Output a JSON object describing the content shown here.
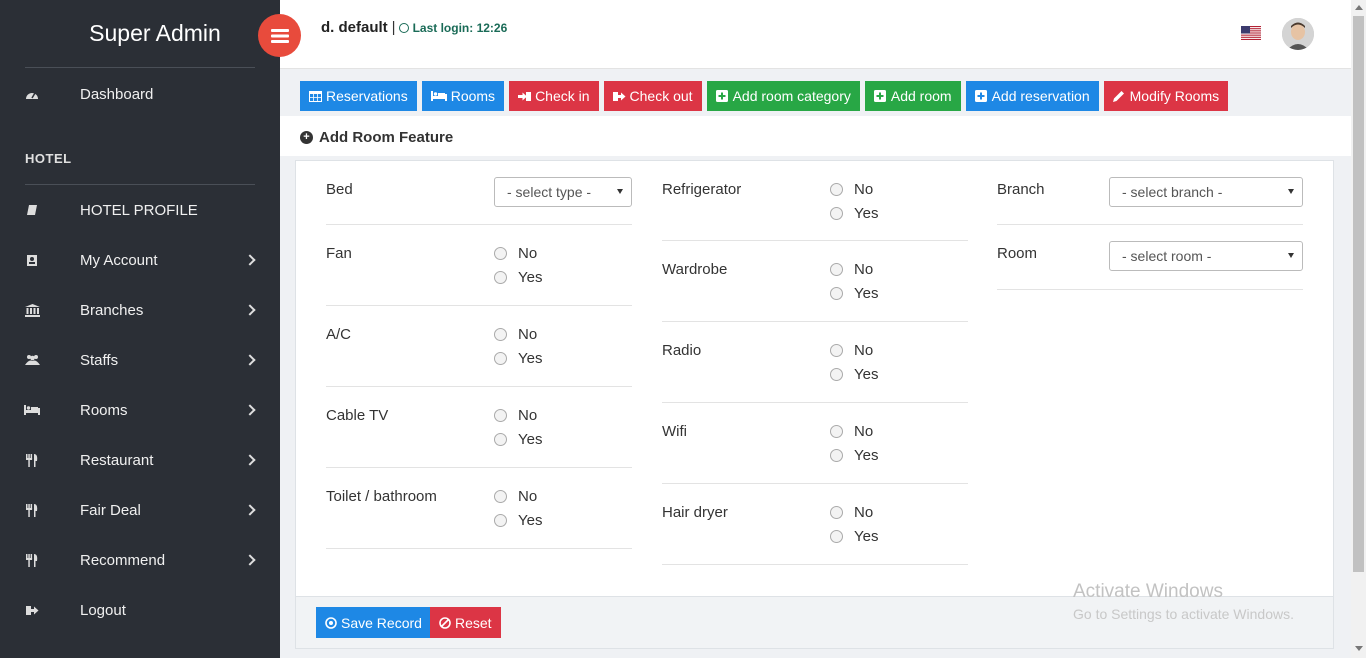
{
  "sidebar": {
    "brand": "Super Admin",
    "dashboard": {
      "label": "Dashboard",
      "icon": "dashboard-icon"
    },
    "section_title": "HOTEL",
    "items": [
      {
        "label": "HOTEL PROFILE",
        "icon": "book-icon"
      },
      {
        "label": "My Account",
        "icon": "account-icon"
      },
      {
        "label": "Branches",
        "icon": "bank-icon"
      },
      {
        "label": "Staffs",
        "icon": "users-icon"
      },
      {
        "label": "Rooms",
        "icon": "bed-icon"
      },
      {
        "label": "Restaurant",
        "icon": "cutlery-icon"
      },
      {
        "label": "Fair Deal",
        "icon": "cutlery-icon"
      },
      {
        "label": "Recommend",
        "icon": "cutlery-icon"
      },
      {
        "label": "Logout",
        "icon": "sign-out-icon"
      }
    ]
  },
  "header": {
    "user_name": "d. default",
    "separator": "|",
    "last_login": "Last login: 12:26"
  },
  "actions": [
    {
      "label": "Reservations",
      "color": "#1e88e5",
      "icon": "calendar-icon"
    },
    {
      "label": "Rooms",
      "color": "#1e88e5",
      "icon": "bed-icon"
    },
    {
      "label": "Check in",
      "color": "#dc3545",
      "icon": "sign-in-icon"
    },
    {
      "label": "Check out",
      "color": "#dc3545",
      "icon": "sign-out-icon"
    },
    {
      "label": "Add room category",
      "color": "#28a745",
      "icon": "plus-square-icon"
    },
    {
      "label": "Add room",
      "color": "#28a745",
      "icon": "plus-square-icon"
    },
    {
      "label": "Add reservation",
      "color": "#1e88e5",
      "icon": "plus-square-icon"
    },
    {
      "label": "Modify Rooms",
      "color": "#dc3545",
      "icon": "pencil-icon"
    }
  ],
  "page_title": "Add Room Feature",
  "form": {
    "bed": {
      "label": "Bed",
      "placeholder": "- select type -"
    },
    "fan": {
      "label": "Fan"
    },
    "ac": {
      "label": "A/C"
    },
    "cable_tv": {
      "label": "Cable TV"
    },
    "toilet": {
      "label": "Toilet / bathroom"
    },
    "refrigerator": {
      "label": "Refrigerator"
    },
    "wardrobe": {
      "label": "Wardrobe"
    },
    "radio": {
      "label": "Radio"
    },
    "wifi": {
      "label": "Wifi"
    },
    "hair_dryer": {
      "label": "Hair dryer"
    },
    "branch": {
      "label": "Branch",
      "placeholder": "- select branch -"
    },
    "room": {
      "label": "Room",
      "placeholder": "- select room -"
    },
    "option_no": "No",
    "option_yes": "Yes"
  },
  "footer": {
    "save_label": "Save Record",
    "reset_label": "Reset"
  },
  "watermark": {
    "line1": "Activate Windows",
    "line2": "Go to Settings to activate Windows."
  }
}
